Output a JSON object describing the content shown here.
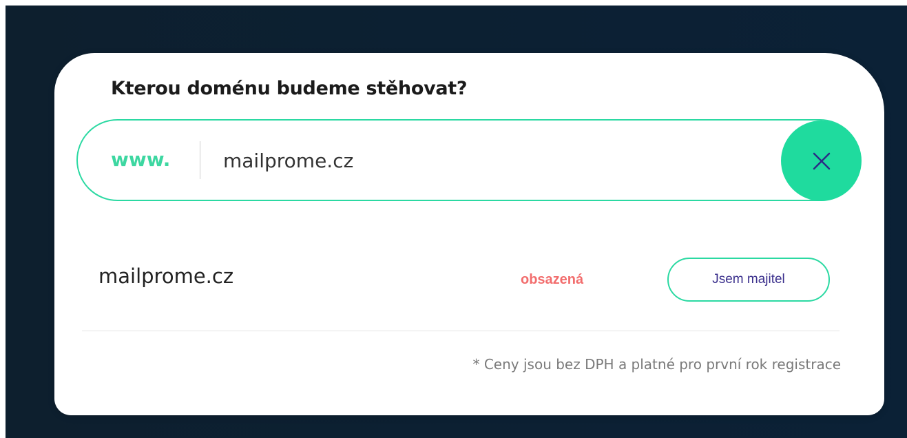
{
  "dialog": {
    "title": "Kterou doménu budeme stěhovat?"
  },
  "search": {
    "prefix": "www.",
    "value": "mailprome.cz",
    "clear_icon": "close-icon",
    "accent_color": "#1fdb9e"
  },
  "result": {
    "domain": "mailprome.cz",
    "status": "obsazená",
    "status_color": "#f26d6d",
    "action_label": "Jsem majitel"
  },
  "footnote": "* Ceny jsou bez DPH a platné pro první rok registrace"
}
